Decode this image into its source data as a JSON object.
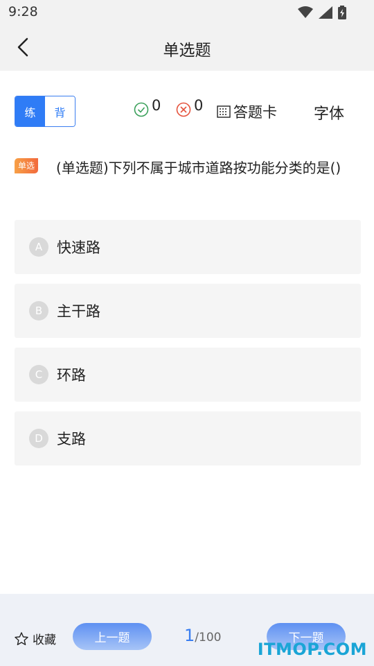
{
  "status_bar": {
    "time": "9:28"
  },
  "nav": {
    "title": "单选题"
  },
  "toolbar": {
    "mode_practice": "练",
    "mode_memorize": "背",
    "correct_count": "0",
    "wrong_count": "0",
    "answer_card": "答题卡",
    "font": "字体"
  },
  "question": {
    "tag": "单选",
    "text": "(单选题)下列不属于城市道路按功能分类的是()"
  },
  "options": [
    {
      "letter": "A",
      "text": "快速路"
    },
    {
      "letter": "B",
      "text": "主干路"
    },
    {
      "letter": "C",
      "text": "环路"
    },
    {
      "letter": "D",
      "text": "支路"
    }
  ],
  "footer": {
    "favorite": "收藏",
    "prev": "上一题",
    "current": "1",
    "total": "/100",
    "next": "下一题"
  },
  "watermark": "ITMOP.COM",
  "colors": {
    "accent": "#2f7cf6",
    "correct": "#3aa05a",
    "wrong": "#e5533d",
    "tag": "#f2843d"
  }
}
